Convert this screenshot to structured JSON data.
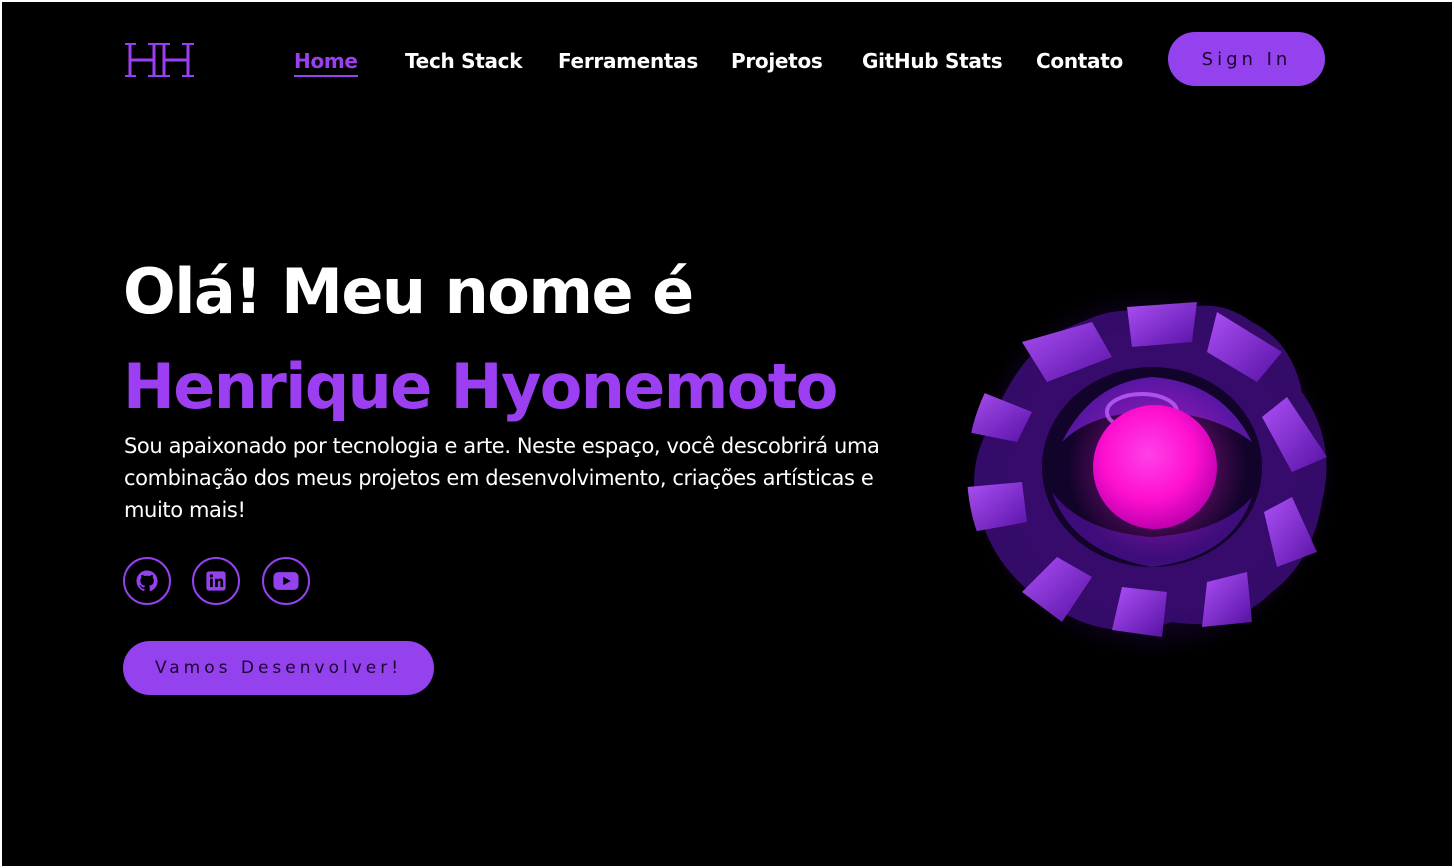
{
  "logo": {
    "text": "HH",
    "color": "#9c3ff3"
  },
  "nav": {
    "items": [
      {
        "label": "Home",
        "active": true
      },
      {
        "label": "Tech Stack",
        "active": false
      },
      {
        "label": "Ferramentas",
        "active": false
      },
      {
        "label": "Projetos",
        "active": false
      },
      {
        "label": "GitHub Stats",
        "active": false
      },
      {
        "label": "Contato",
        "active": false
      }
    ],
    "signin_label": "Sign In"
  },
  "hero": {
    "greeting": "Olá! Meu nome é",
    "name": "Henrique Hyonemoto",
    "description": "Sou apaixonado por tecnologia e arte. Neste espaço, você descobrirá uma combinação dos meus projetos em desenvolvimento, criações artísticas e muito mais!",
    "socials": [
      {
        "icon": "github-icon"
      },
      {
        "icon": "linkedin-icon"
      },
      {
        "icon": "youtube-icon"
      }
    ],
    "cta_label": "Vamos Desenvolver!"
  },
  "colors": {
    "accent": "#9442ee",
    "accent_text": "#9c3ff3",
    "background": "#000000",
    "orb": "#ff10d0"
  }
}
